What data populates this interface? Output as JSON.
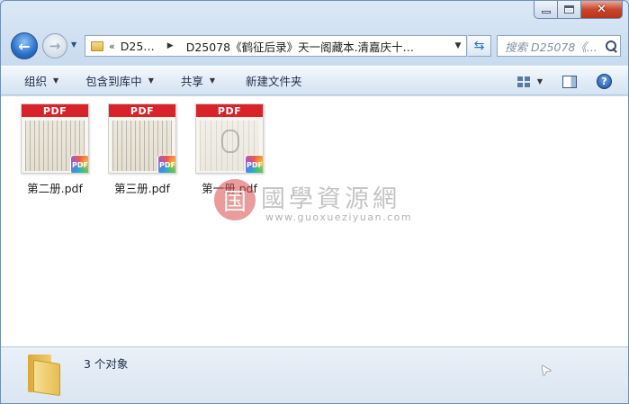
{
  "window": {
    "caption_buttons": {
      "minimize_icon": "minimize-icon",
      "maximize_icon": "maximize-icon",
      "close_icon": "close-icon"
    }
  },
  "nav": {
    "back_icon": "back-arrow-icon",
    "forward_icon": "forward-arrow-icon",
    "history_icon": "chevron-down-icon"
  },
  "address": {
    "overflow": "«",
    "segments": [
      "D25…",
      "D25078《鹤征后录》天一阁藏本.清嘉庆十…"
    ]
  },
  "search": {
    "placeholder": "搜索 D25078《..."
  },
  "toolbar": {
    "organize": "组织",
    "include_library": "包含到库中",
    "share": "共享",
    "new_folder": "新建文件夹"
  },
  "files": [
    {
      "name": "第二册.pdf",
      "band": "PDF",
      "badge": "PDF"
    },
    {
      "name": "第三册.pdf",
      "band": "PDF",
      "badge": "PDF"
    },
    {
      "name": "第一册.pdf",
      "band": "PDF",
      "badge": "PDF"
    }
  ],
  "watermark": {
    "logo": "国",
    "title": "國學資源網",
    "url": "www.guoxueziyuan.com"
  },
  "status": {
    "count": "3 个对象"
  },
  "colors": {
    "pdf_band": "#d8232a",
    "content_bg": "#ffffff",
    "toolbar": "#dce8f5"
  }
}
